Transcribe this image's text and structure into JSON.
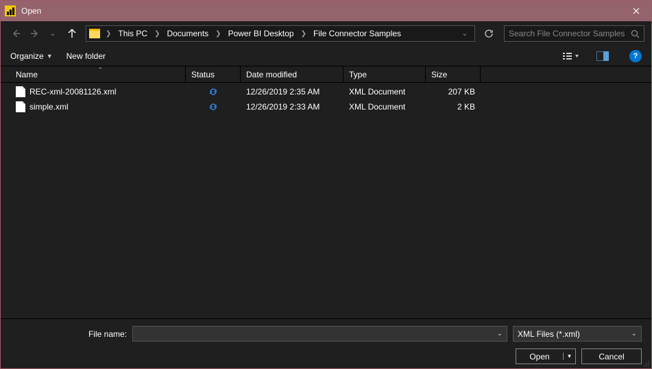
{
  "window": {
    "title": "Open"
  },
  "breadcrumbs": [
    "This PC",
    "Documents",
    "Power BI Desktop",
    "File Connector Samples"
  ],
  "search": {
    "placeholder": "Search File Connector Samples"
  },
  "toolbar": {
    "organize": "Organize",
    "newfolder": "New folder",
    "help": "?"
  },
  "columns": {
    "name": "Name",
    "status": "Status",
    "date": "Date modified",
    "type": "Type",
    "size": "Size"
  },
  "files": [
    {
      "name": "REC-xml-20081126.xml",
      "date": "12/26/2019 2:35 AM",
      "type": "XML Document",
      "size": "207 KB"
    },
    {
      "name": "simple.xml",
      "date": "12/26/2019 2:33 AM",
      "type": "XML Document",
      "size": "2 KB"
    }
  ],
  "footer": {
    "filename_label": "File name:",
    "filename_value": "",
    "filter": "XML Files (*.xml)",
    "open": "Open",
    "cancel": "Cancel"
  }
}
